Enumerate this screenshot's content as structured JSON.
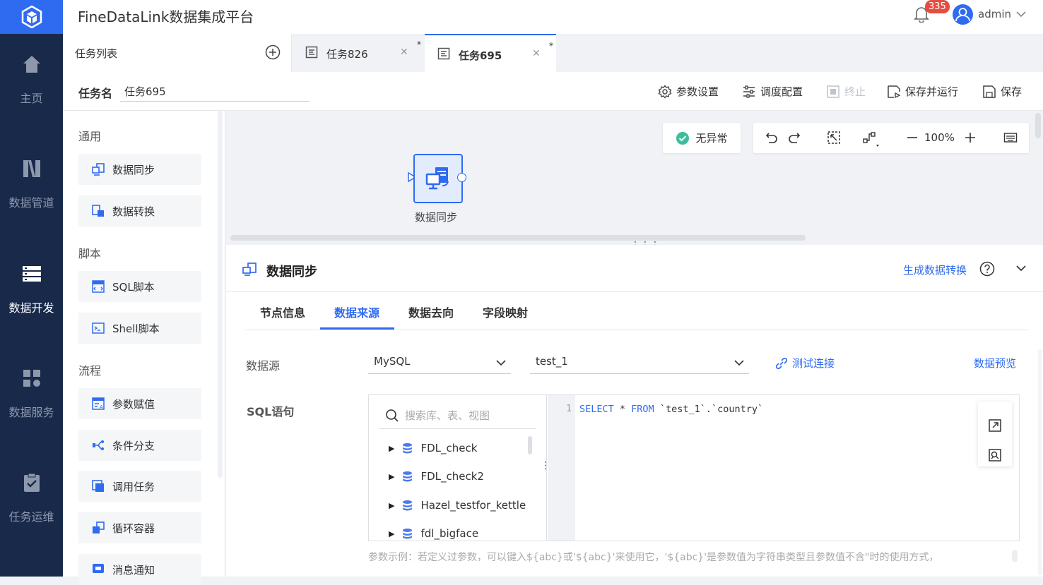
{
  "app": {
    "title": "FineDataLink数据集成平台",
    "notification_count": "335",
    "username": "admin"
  },
  "nav": {
    "items": [
      {
        "label": "主页",
        "icon": "home-icon"
      },
      {
        "label": "数据管道",
        "icon": "pipeline-icon"
      },
      {
        "label": "数据开发",
        "icon": "dev-icon",
        "active": true
      },
      {
        "label": "数据服务",
        "icon": "service-icon"
      },
      {
        "label": "任务运维",
        "icon": "ops-icon"
      }
    ]
  },
  "tasklist": {
    "label": "任务列表"
  },
  "tabs": [
    {
      "label": "任务826",
      "modified": "*",
      "active": false
    },
    {
      "label": "任务695",
      "modified": "*",
      "active": true
    }
  ],
  "taskbar": {
    "name_label": "任务名",
    "name_value": "任务695",
    "params_label": "参数设置",
    "schedule_label": "调度配置",
    "stop_label": "终止",
    "save_run_label": "保存并运行",
    "save_label": "保存"
  },
  "palette": {
    "sections": [
      {
        "title": "通用",
        "items": [
          "数据同步",
          "数据转换"
        ]
      },
      {
        "title": "脚本",
        "items": [
          "SQL脚本",
          "Shell脚本"
        ]
      },
      {
        "title": "流程",
        "items": [
          "参数赋值",
          "条件分支",
          "调用任务",
          "循环容器",
          "消息通知"
        ]
      }
    ]
  },
  "canvas": {
    "status": "无异常",
    "zoom": "100%",
    "node_label": "数据同步"
  },
  "panel": {
    "title": "数据同步",
    "generate_link": "生成数据转换",
    "subtabs": [
      "节点信息",
      "数据来源",
      "数据去向",
      "字段映射"
    ],
    "active_subtab": "数据来源",
    "datasource_label": "数据源",
    "db_type": "MySQL",
    "connection": "test_1",
    "test_link": "测试连接",
    "preview_link": "数据预览",
    "sql_label": "SQL语句",
    "search_placeholder": "搜索库、表、视图",
    "tree": [
      "FDL_check",
      "FDL_check2",
      "Hazel_testfor_kettle",
      "fdl_bigface"
    ],
    "line_number": "1",
    "code": {
      "kw1": "SELECT",
      "mid": " * ",
      "kw2": "FROM",
      "rest": " `test_1`.`country`"
    },
    "hint": "参数示例：若定义过参数，可以键入${abc}或'${abc}'来使用它，'${abc}'是参数值为字符串类型且参数值不含\"时的使用方式，"
  },
  "colors": {
    "accent": "#2f6bf1",
    "nav_bg": "#18294a",
    "success": "#3dbd9d"
  }
}
